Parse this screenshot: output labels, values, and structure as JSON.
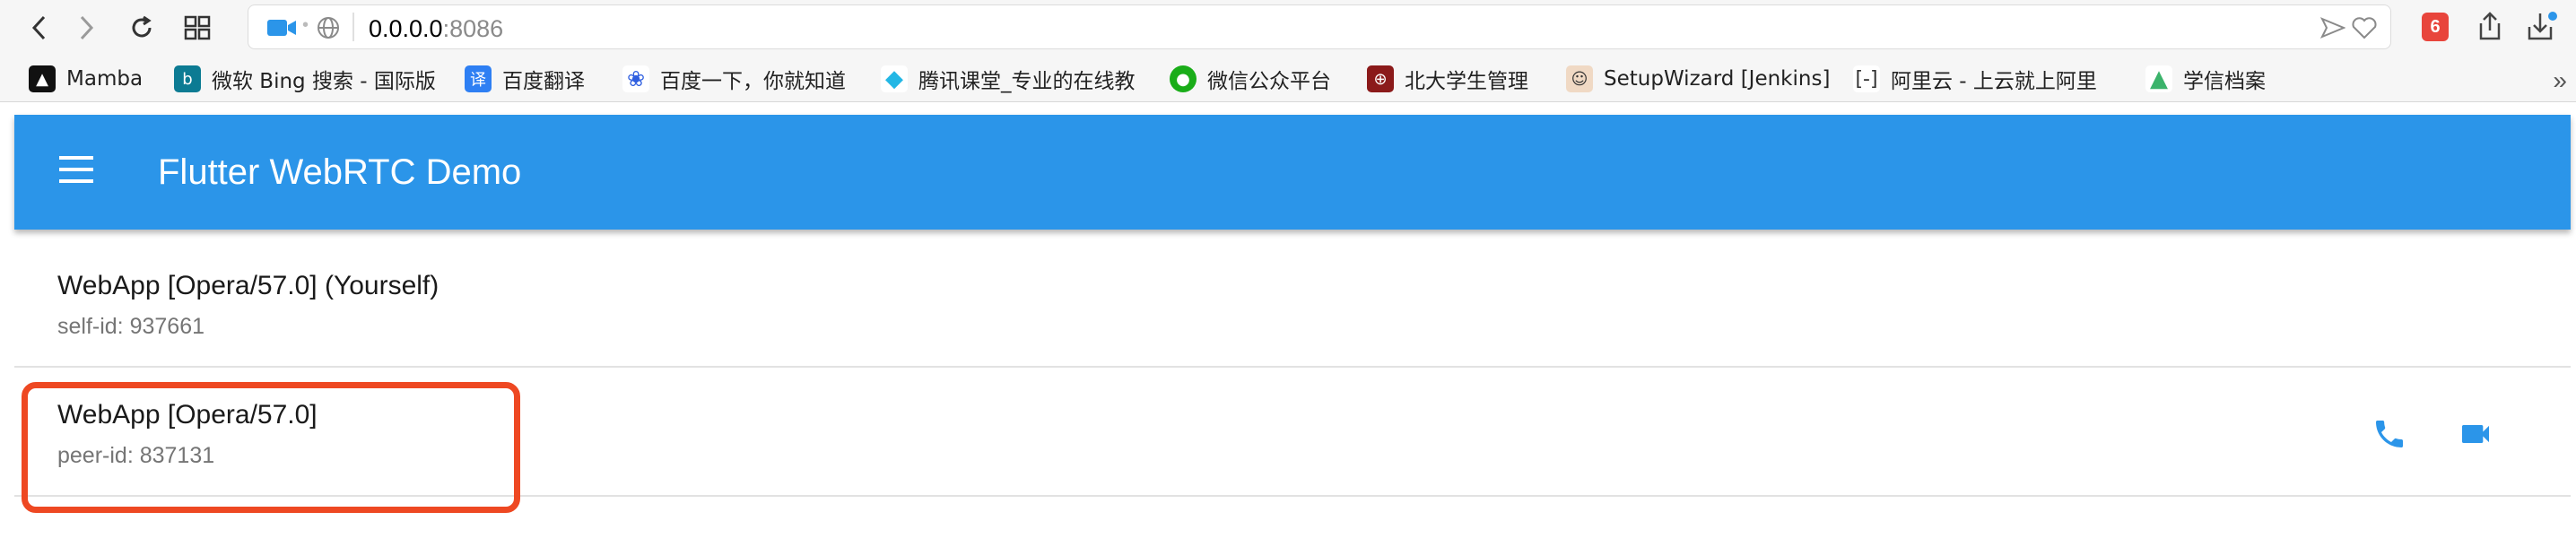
{
  "browser": {
    "url_host": "0.0.0.0",
    "url_port": ":8086",
    "badge_count": "6"
  },
  "bookmarks": [
    {
      "label": "Mamba",
      "icon": "mamba-icon",
      "color": "#222222"
    },
    {
      "label": "微软 Bing 搜索 - 国际版",
      "icon": "bing-icon",
      "color": "#0c7b93"
    },
    {
      "label": "百度翻译",
      "icon": "baidu-translate-icon",
      "color": "#2e7ff3"
    },
    {
      "label": "百度一下，你就知道",
      "icon": "baidu-paw-icon",
      "color": "#2f5fe0"
    },
    {
      "label": "腾讯课堂_专业的在线教",
      "icon": "tencent-classroom-icon",
      "color": "#23b7e5"
    },
    {
      "label": "微信公众平台",
      "icon": "wechat-icon",
      "color": "#1aad19"
    },
    {
      "label": "北大学生管理",
      "icon": "pku-icon",
      "color": "#8b1a1a"
    },
    {
      "label": "SetupWizard [Jenkins]",
      "icon": "jenkins-icon",
      "color": "#d24939"
    },
    {
      "label": "阿里云 - 上云就上阿里",
      "icon": "aliyun-icon",
      "color": "#333333"
    },
    {
      "label": "学信档案",
      "icon": "chsi-icon",
      "color": "#3bb36b"
    }
  ],
  "appbar": {
    "title": "Flutter WebRTC Demo",
    "color": "#2b95e9"
  },
  "peers": [
    {
      "title": "WebApp [Opera/57.0] (Yourself)",
      "subtitle": "self-id: 937661",
      "has_actions": false
    },
    {
      "title": "WebApp [Opera/57.0]",
      "subtitle": "peer-id: 837131",
      "has_actions": true
    }
  ],
  "colors": {
    "accent": "#2b95e9",
    "highlight": "#ee4822"
  }
}
